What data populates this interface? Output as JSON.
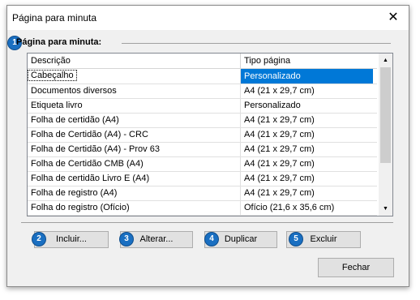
{
  "window": {
    "title": "Página para minuta",
    "close_glyph": "✕"
  },
  "group": {
    "title": "Página para minuta:"
  },
  "badges": [
    "1",
    "2",
    "3",
    "4",
    "5"
  ],
  "grid": {
    "columns": [
      "Descrição",
      "Tipo página"
    ],
    "rows": [
      [
        "Cabeçalho",
        "Personalizado"
      ],
      [
        "Documentos diversos",
        "A4 (21 x 29,7 cm)"
      ],
      [
        "Etiqueta livro",
        "Personalizado"
      ],
      [
        "Folha de certidão (A4)",
        "A4 (21 x 29,7 cm)"
      ],
      [
        "Folha de Certidão (A4) - CRC",
        "A4 (21 x 29,7 cm)"
      ],
      [
        "Folha de Certidão (A4) - Prov 63",
        "A4 (21 x 29,7 cm)"
      ],
      [
        "Folha de Certidão CMB (A4)",
        "A4 (21 x 29,7 cm)"
      ],
      [
        "Folha de certidão Livro E (A4)",
        "A4 (21 x 29,7 cm)"
      ],
      [
        "Folha de registro (A4)",
        "A4 (21 x 29,7 cm)"
      ],
      [
        "Folha do registro (Ofício)",
        "Ofício (21,6 x 35,6 cm)"
      ]
    ],
    "selected_row": 0
  },
  "buttons": {
    "include": "Incluir...",
    "edit": "Alterar...",
    "duplicate": "Duplicar",
    "delete": "Excluir",
    "close": "Fechar"
  },
  "colors": {
    "selection": "#0078d7",
    "badge": "#1a6fc1"
  }
}
